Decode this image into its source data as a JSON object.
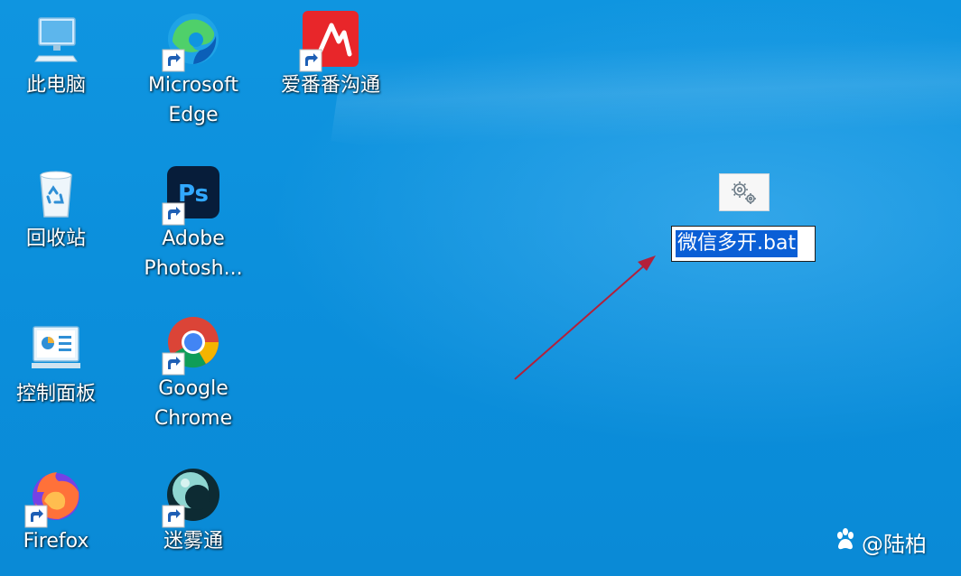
{
  "desktop": {
    "icons": [
      {
        "id": "this-pc",
        "label": "此电脑"
      },
      {
        "id": "edge",
        "label": "Microsoft\nEdge"
      },
      {
        "id": "aifanfan",
        "label": "爱番番沟通"
      },
      {
        "id": "recycle-bin",
        "label": "回收站"
      },
      {
        "id": "photoshop",
        "label": "Adobe\nPhotosh..."
      },
      {
        "id": "control-panel",
        "label": "控制面板"
      },
      {
        "id": "chrome",
        "label": "Google\nChrome"
      },
      {
        "id": "firefox",
        "label": "Firefox"
      },
      {
        "id": "miwutong",
        "label": "迷雾通"
      }
    ],
    "bat_file": {
      "name": "微信多开.bat",
      "icon": "gear-batch-file-icon"
    }
  },
  "watermark": {
    "text": "@陆柏",
    "icon": "baidu-paw-icon"
  },
  "colors": {
    "desktop": "#0a91dd",
    "selection": "#0a5fd6",
    "arrow": "#b3203a"
  }
}
